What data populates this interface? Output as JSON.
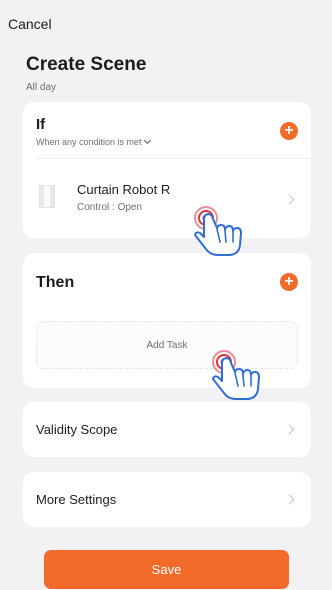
{
  "header": {
    "cancel_label": "Cancel",
    "title": "Create Scene",
    "subtitle": "All day"
  },
  "if_section": {
    "title": "If",
    "condition": "When any condition is met",
    "device": {
      "name": "Curtain Robot  R",
      "control": "Control : Open"
    }
  },
  "then_section": {
    "title": "Then",
    "add_task_label": "Add Task"
  },
  "validity": {
    "label": "Validity Scope"
  },
  "more": {
    "label": "More Settings"
  },
  "save_label": "Save",
  "colors": {
    "accent": "#f26b2a",
    "background": "#f2f2f4",
    "card": "#ffffff",
    "hand_outline": "#2f6fd3",
    "tap_indicator": "#e0323c"
  },
  "icons": {
    "plus": "+",
    "device": "curtain-device-icon",
    "chevron": "chevron-right-icon",
    "tap": "tap-hand-icon"
  }
}
